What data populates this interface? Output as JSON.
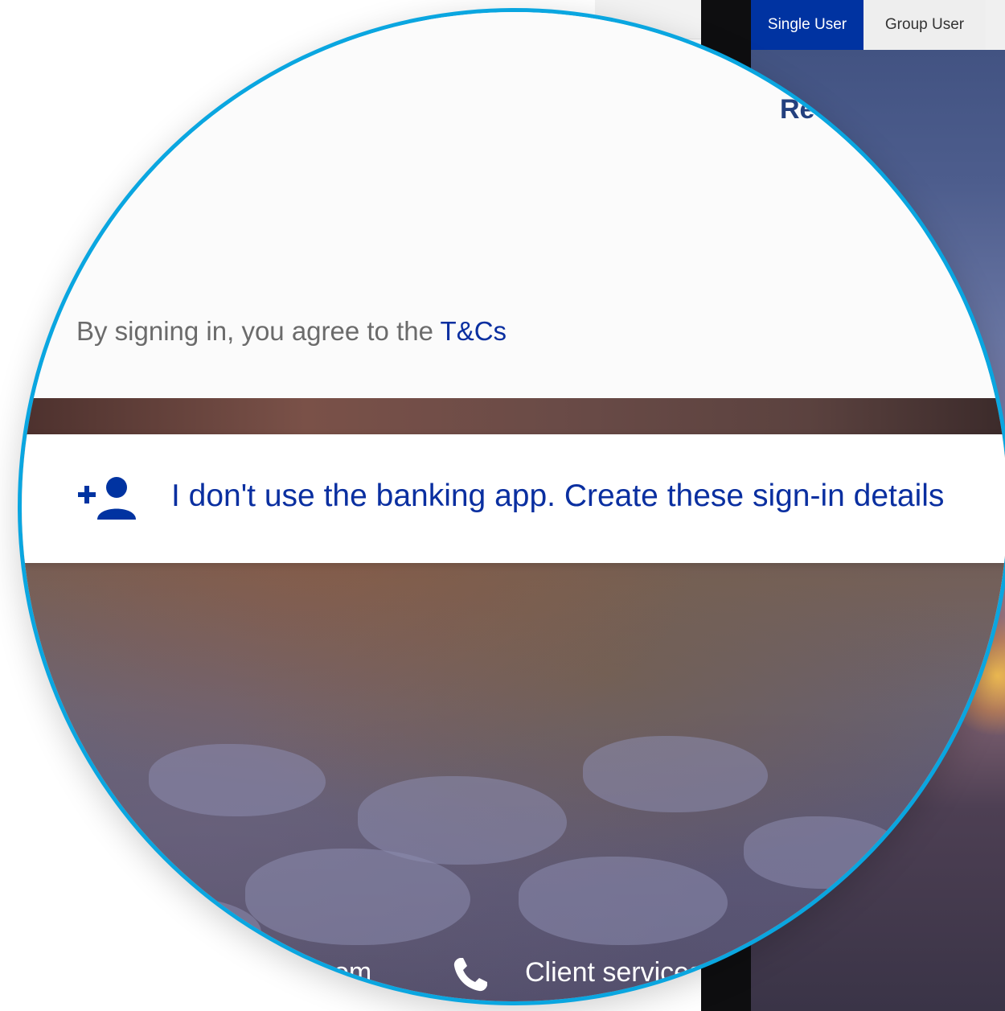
{
  "tabs": {
    "single_user": "Single User",
    "group_user": "Group User"
  },
  "page": {
    "partial_heading": "Re",
    "agree_prefix": "By signing in, you agree to the ",
    "tcs_link": "T&Cs",
    "create_details_link": "I don't use the banking app. Create these sign-in details"
  },
  "footer": {
    "partial_left_text": "om",
    "client_services": "Client services"
  },
  "icons": {
    "create_user": "add-person-icon",
    "phone": "phone-icon"
  },
  "colors": {
    "brand_blue": "#0033a1",
    "link_blue": "#0a2fa0",
    "magnifier_ring": "#0aa6e0"
  }
}
